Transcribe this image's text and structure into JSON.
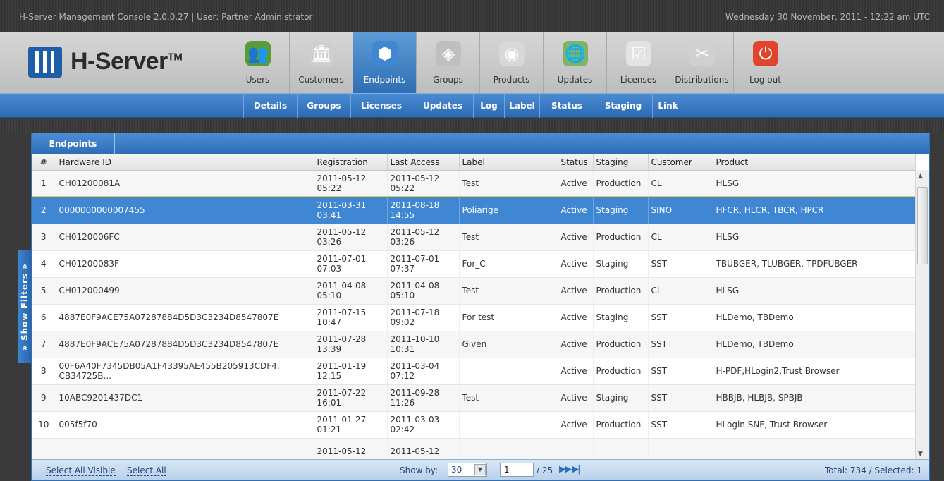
{
  "topbar": {
    "title": "H-Server Management Console 2.0.0.27 | User: Partner Administrator",
    "datetime": "Wednesday 30 November, 2011 - 12:22 am UTC"
  },
  "logo": {
    "text": "H-Server",
    "tm": "TM"
  },
  "nav": [
    {
      "label": "Users",
      "icon": "users-icon"
    },
    {
      "label": "Customers",
      "icon": "bank-icon"
    },
    {
      "label": "Endpoints",
      "icon": "network-icon",
      "active": true
    },
    {
      "label": "Groups",
      "icon": "cubes-icon"
    },
    {
      "label": "Products",
      "icon": "disc-icon"
    },
    {
      "label": "Updates",
      "icon": "globe-icon"
    },
    {
      "label": "Licenses",
      "icon": "checklist-icon"
    },
    {
      "label": "Distributions",
      "icon": "tools-icon"
    },
    {
      "label": "Log out",
      "icon": "power-icon"
    }
  ],
  "subnav": [
    "Details",
    "Groups",
    "Licenses",
    "Updates",
    "Log",
    "Label",
    "Status",
    "Staging",
    "Link"
  ],
  "panel": {
    "tab": "Endpoints",
    "filters_tab": "» Show Filters »"
  },
  "columns": [
    "#",
    "Hardware ID",
    "Registration",
    "Last Access",
    "Label",
    "Status",
    "Staging",
    "Customer",
    "Product"
  ],
  "rows": [
    [
      "1",
      "CH01200081A",
      "2011-05-12 05:22",
      "2011-05-12 05:22",
      "Test",
      "Active",
      "Production",
      "CL",
      "HLSG"
    ],
    [
      "2",
      "0000000000007455",
      "2011-03-31 03:41",
      "2011-08-18 14:55",
      "Poliarige",
      "Active",
      "Staging",
      "SINO",
      "HFCR, HLCR, TBCR, HPCR"
    ],
    [
      "3",
      "CH0120006FC",
      "2011-05-12 03:26",
      "2011-05-12 03:26",
      "Test",
      "Active",
      "Production",
      "CL",
      "HLSG"
    ],
    [
      "4",
      "CH01200083F",
      "2011-07-01 07:03",
      "2011-07-01 07:37",
      "For_C",
      "Active",
      "Staging",
      "SST",
      "TBUBGER, TLUBGER, TPDFUBGER"
    ],
    [
      "5",
      "CH012000499",
      "2011-04-08 05:10",
      "2011-04-08 05:10",
      "Test",
      "Active",
      "Production",
      "CL",
      "HLSG"
    ],
    [
      "6",
      "4887E0F9ACE75A07287884D5D3C3234D8547807E",
      "2011-07-15 10:47",
      "2011-07-18 09:02",
      "For test",
      "Active",
      "Staging",
      "SST",
      "HLDemo, TBDemo"
    ],
    [
      "7",
      "4887E0F9ACE75A07287884D5D3C3234D8547807E",
      "2011-07-28 13:39",
      "2011-10-10 10:31",
      "Given",
      "Active",
      "Production",
      "SST",
      "HLDemo, TBDemo"
    ],
    [
      "8",
      "00F6A40F7345DB05A1F43395AE455B205913CDF4, CB34725B...",
      "2011-01-19 12:15",
      "2011-03-04 07:12",
      "",
      "Active",
      "Production",
      "SST",
      "H-PDF,HLogin2,Trust Browser"
    ],
    [
      "9",
      "10ABC9201437DC1",
      "2011-07-22 16:01",
      "2011-09-28 11:26",
      "Test",
      "Active",
      "Staging",
      "SST",
      "HBBJB, HLBJB, SPBJB"
    ],
    [
      "10",
      "005f5f70",
      "2011-01-27 01:21",
      "2011-03-03 02:42",
      "",
      "Active",
      "Production",
      "SST",
      "HLogin SNF, Trust Browser"
    ],
    [
      "",
      "",
      "2011-05-12",
      "2011-05-12",
      "",
      "",
      "",
      "",
      ""
    ]
  ],
  "selected_row": 2,
  "footer": {
    "select_visible": "Select All Visible",
    "select_all": "Select All",
    "show_by_label": "Show by:",
    "show_by_value": "30",
    "page": "1",
    "pages": "/ 25",
    "total": "Total: 734 / Selected: 1"
  },
  "colors": {
    "accent": "#2f6fb3",
    "selected_row": "#3f87d3",
    "header_dark": "#3a3a3a"
  }
}
